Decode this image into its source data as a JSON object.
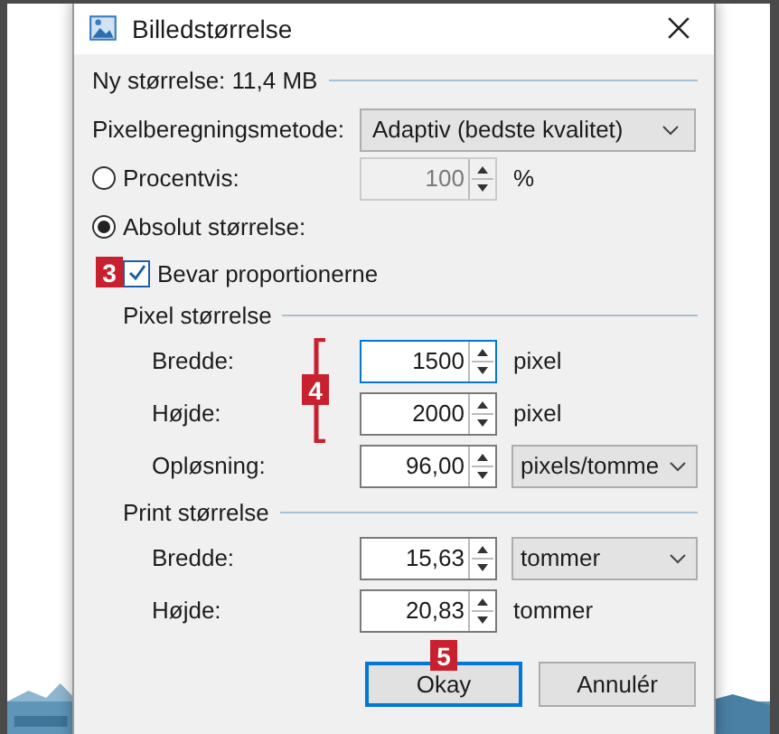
{
  "window": {
    "title": "Billedstørrelse"
  },
  "new_size": "Ny størrelse: 11,4 MB",
  "resample": {
    "label": "Pixelberegningsmetode:",
    "value": "Adaptiv (bedste kvalitet)"
  },
  "modes": [
    {
      "label": "Procentvis:",
      "selected": false
    },
    {
      "label": "Absolut størrelse:",
      "selected": true
    }
  ],
  "percent": {
    "value": "100",
    "unit": "%",
    "disabled": true
  },
  "keep_proportions": {
    "label": "Bevar proportionerne",
    "checked": true
  },
  "pixel_size": {
    "title": "Pixel størrelse",
    "rows": [
      {
        "label": "Bredde:",
        "value": "1500",
        "unit": "pixel",
        "kind": "text",
        "focused": true
      },
      {
        "label": "Højde:",
        "value": "2000",
        "unit": "pixel",
        "kind": "text",
        "focused": false
      },
      {
        "label": "Opløsning:",
        "value": "96,00",
        "unit": "pixels/tomme",
        "kind": "dropdown",
        "focused": false
      }
    ]
  },
  "print_size": {
    "title": "Print størrelse",
    "rows": [
      {
        "label": "Bredde:",
        "value": "15,63",
        "unit": "tommer",
        "kind": "dropdown",
        "focused": false
      },
      {
        "label": "Højde:",
        "value": "20,83",
        "unit": "tommer",
        "kind": "text",
        "focused": false
      }
    ]
  },
  "buttons": [
    {
      "label": "Okay",
      "default": true
    },
    {
      "label": "Annulér",
      "default": false
    }
  ],
  "annotations": [
    "3",
    "4",
    "5"
  ]
}
